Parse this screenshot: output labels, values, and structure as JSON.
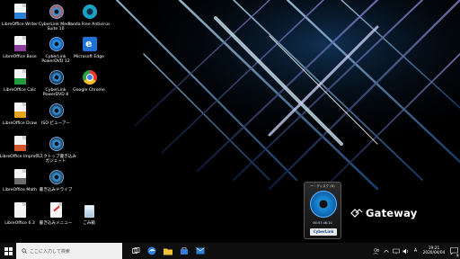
{
  "desktop": {
    "icons": [
      {
        "label": "LibreOffice Writer",
        "icon": "libreoffice-writer-icon",
        "color": "#2a7fd6"
      },
      {
        "label": "LibreOffice Base",
        "icon": "libreoffice-base-icon",
        "color": "#8e3d9d"
      },
      {
        "label": "LibreOffice Calc",
        "icon": "libreoffice-calc-icon",
        "color": "#1e9a3c"
      },
      {
        "label": "LibreOffice Draw",
        "icon": "libreoffice-draw-icon",
        "color": "#e5a21a"
      },
      {
        "label": "LibreOffice Impress",
        "icon": "libreoffice-impress-icon",
        "color": "#d2542a"
      },
      {
        "label": "LibreOffice Math",
        "icon": "libreoffice-math-icon",
        "color": "#6b6b6b"
      },
      {
        "label": "LibreOffice 6.3",
        "icon": "libreoffice-icon",
        "color": "#f2f2f2"
      },
      {
        "label": "CyberLink Media Suite 10",
        "icon": "cyberlink-media-suite-icon",
        "color": "#d34b2a"
      },
      {
        "label": "CyberLink PowerDVD 12",
        "icon": "cyberlink-powerdvd-icon",
        "color": "#1a4c9c"
      },
      {
        "label": "CyberLink PowerDVD 8",
        "icon": "cyberlink-power2go-icon",
        "color": "#1d1d1d"
      },
      {
        "label": "ISO ビューアー",
        "icon": "iso-viewer-icon",
        "color": "#222"
      },
      {
        "label": "デスクトップ書き込み ガジェット",
        "icon": "desktop-burning-gadget-icon",
        "color": "#333"
      },
      {
        "label": "書き込みドライブ",
        "icon": "burning-drive-icon",
        "color": "#333"
      },
      {
        "label": "書き込みメニュー",
        "icon": "burning-menu-icon",
        "color": "#f1f1f1"
      },
      {
        "label": "Panda Free Antivirus",
        "icon": "panda-antivirus-icon",
        "color": "#1aa3c7"
      },
      {
        "label": "Microsoft Edge",
        "icon": "microsoft-edge-icon",
        "color": "#1e73d8"
      },
      {
        "label": "Google Chrome",
        "icon": "google-chrome-icon",
        "color": "#e33b2e"
      },
      {
        "label": "ごみ箱",
        "icon": "recycle-bin-icon",
        "color": "#d9e6f2"
      }
    ]
  },
  "gadget": {
    "title": "ー・ディスク (D)",
    "time": "00:57:46:10",
    "brand": "CyberLink"
  },
  "logo": {
    "brand": "Gateway"
  },
  "taskbar": {
    "search_placeholder": "ここに入力して検索",
    "ime": "A",
    "time": "19:21",
    "date": "2020/04/04",
    "notification_count": "5"
  }
}
